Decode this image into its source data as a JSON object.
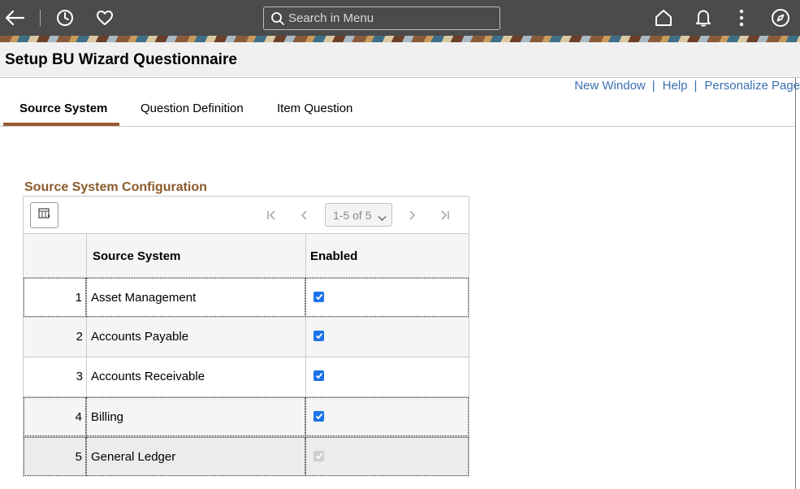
{
  "header": {
    "search_placeholder": "Search in Menu"
  },
  "page": {
    "title": "Setup BU Wizard Questionnaire"
  },
  "links": {
    "new_window": "New Window",
    "help": "Help",
    "personalize": "Personalize Page",
    "separator": "|"
  },
  "tabs": [
    {
      "label": "Source System",
      "active": true
    },
    {
      "label": "Question Definition",
      "active": false
    },
    {
      "label": "Item Question",
      "active": false
    }
  ],
  "section": {
    "title": "Source System Configuration"
  },
  "grid": {
    "pager_label": "1-5 of 5",
    "columns": [
      "",
      "Source System",
      "Enabled"
    ],
    "rows": [
      {
        "num": "1",
        "name": "Asset Management",
        "enabled": true,
        "editable": true
      },
      {
        "num": "2",
        "name": "Accounts Payable",
        "enabled": true,
        "editable": true
      },
      {
        "num": "3",
        "name": "Accounts Receivable",
        "enabled": true,
        "editable": true
      },
      {
        "num": "4",
        "name": "Billing",
        "enabled": true,
        "editable": true
      },
      {
        "num": "5",
        "name": "General Ledger",
        "enabled": true,
        "editable": false
      }
    ]
  },
  "colors": {
    "topbar": "#4b4b4b",
    "section_title": "#8b5a2b",
    "tab_underline": "#9a5a32",
    "link": "#3a6fb0",
    "checkbox": "#1a73e8"
  },
  "icons": [
    "back-arrow-icon",
    "recent-clock-icon",
    "favorites-heart-icon",
    "search-icon",
    "home-icon",
    "notifications-bell-icon",
    "actions-kebab-icon",
    "navbar-compass-icon",
    "grid-options-icon",
    "first-page-icon",
    "previous-page-icon",
    "next-page-icon",
    "last-page-icon",
    "chevron-down-icon"
  ]
}
